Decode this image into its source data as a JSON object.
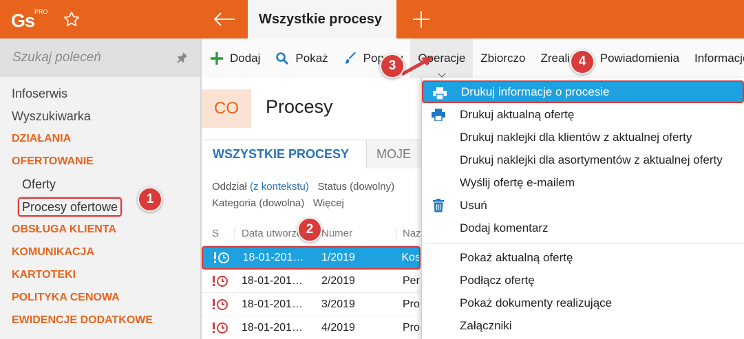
{
  "topbar": {
    "logo_text": "Gs",
    "logo_pro": "PRO",
    "active_tab": "Wszystkie procesy"
  },
  "sidebar": {
    "search_placeholder": "Szukaj poleceń",
    "items": [
      {
        "label": "Infoserwis",
        "kind": "plain"
      },
      {
        "label": "Wyszukiwarka",
        "kind": "plain"
      },
      {
        "label": "DZIAŁANIA",
        "kind": "section"
      },
      {
        "label": "OFERTOWANIE",
        "kind": "section"
      },
      {
        "label": "Oferty",
        "kind": "sub"
      },
      {
        "label": "Procesy ofertowe",
        "kind": "sub-selected"
      },
      {
        "label": "OBSŁUGA KLIENTA",
        "kind": "section"
      },
      {
        "label": "KOMUNIKACJA",
        "kind": "section"
      },
      {
        "label": "KARTOTEKI",
        "kind": "section"
      },
      {
        "label": "POLITYKA CENOWA",
        "kind": "section"
      },
      {
        "label": "EWIDENCJE DODATKOWE",
        "kind": "section"
      }
    ]
  },
  "toolbar": {
    "dodaj": "Dodaj",
    "pokaz": "Pokaż",
    "popraw": "Popraw",
    "operacje": "Operacje",
    "zbiorczo": "Zbiorczo",
    "zrealizuj": "Zrealizuj",
    "powiadomienia": "Powiadomienia",
    "informacje": "Informacje"
  },
  "page": {
    "badge": "CO",
    "title": "Procesy"
  },
  "tabs": {
    "all": "WSZYSTKIE PROCESY",
    "mine": "MOJE"
  },
  "filters": {
    "oddzial_label": "Oddział",
    "oddzial_value": "(z kontekstu)",
    "status": "Status (dowolny)",
    "kategoria": "Kategoria (dowolna)",
    "wiecej": "Więcej"
  },
  "table": {
    "headers": {
      "s": "S",
      "date": "Data utworzenia",
      "num": "Numer",
      "name": "Nazwa"
    },
    "rows": [
      {
        "date": "18-01-201…",
        "num": "1/2019",
        "name": "Kos"
      },
      {
        "date": "18-01-201…",
        "num": "2/2019",
        "name": "Per"
      },
      {
        "date": "18-01-201…",
        "num": "3/2019",
        "name": "Pro"
      },
      {
        "date": "18-01-201…",
        "num": "4/2019",
        "name": "Pro"
      }
    ]
  },
  "dropdown": {
    "items": [
      {
        "label": "Drukuj informacje o procesie",
        "icon": "printer-icon"
      },
      {
        "label": "Drukuj aktualną ofertę",
        "icon": "printer-icon"
      },
      {
        "label": "Drukuj naklejki dla klientów z aktualnej oferty",
        "icon": ""
      },
      {
        "label": "Drukuj naklejki dla asortymentów z aktualnej oferty",
        "icon": ""
      },
      {
        "label": "Wyślij ofertę e-mailem",
        "icon": ""
      },
      {
        "label": "Usuń",
        "icon": "trash-icon"
      },
      {
        "label": "Dodaj komentarz",
        "icon": ""
      },
      {
        "label": "Pokaż aktualną ofertę",
        "icon": ""
      },
      {
        "label": "Podłącz ofertę",
        "icon": ""
      },
      {
        "label": "Pokaż dokumenty realizujące",
        "icon": ""
      },
      {
        "label": "Załączniki",
        "icon": ""
      }
    ]
  },
  "callouts": {
    "c1": "1",
    "c2": "2",
    "c3": "3",
    "c4": "4"
  },
  "colors": {
    "accent": "#e8641c",
    "highlight": "#1ea1e0",
    "callout": "#d93a3a",
    "link": "#2872b8"
  }
}
